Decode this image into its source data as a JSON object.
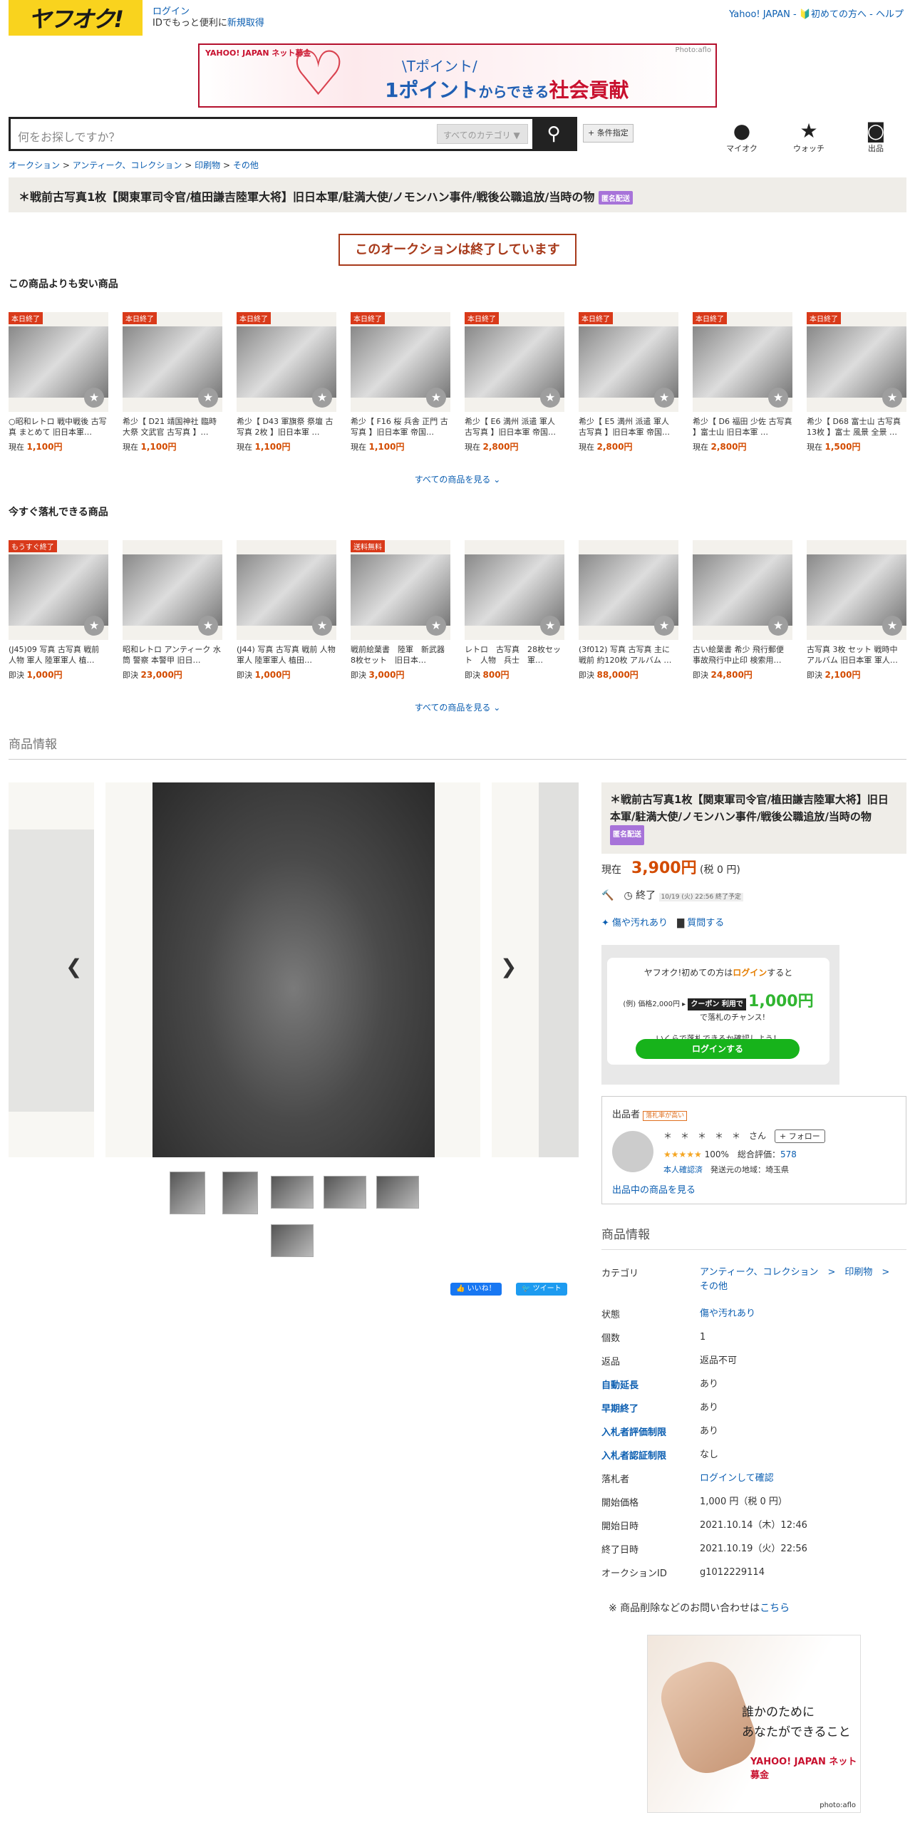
{
  "header": {
    "logo": "ヤフオク!",
    "login": "ログイン",
    "login_sub": "IDでもっと便利に",
    "signup": "新規取得",
    "links": "Yahoo! JAPAN - 🔰初めての方へ - ヘルプ"
  },
  "banner": {
    "brand": "YAHOO! JAPAN ネット募金",
    "line1": "\\Tポイント/",
    "line2a": "1ポイント",
    "line2b": "からできる",
    "line2c": "社会貢献",
    "credit": "Photo:aflo"
  },
  "search": {
    "placeholder": "何をお探しですか？",
    "category": "すべてのカテゴリ",
    "condition": "+ 条件指定"
  },
  "icons": [
    {
      "label": "マイオク",
      "icon": "person-icon"
    },
    {
      "label": "ウォッチ",
      "icon": "star-icon"
    },
    {
      "label": "出品",
      "icon": "camera-icon"
    }
  ],
  "breadcrumb": [
    "オークション",
    "アンティーク、コレクション",
    "印刷物",
    "その他"
  ],
  "title": "＊戦前古写真1枚【関東軍司令官/植田謙吉陸軍大将】旧日本軍/駐満大使/ノモンハン事件/戦後公職追放/当時の物",
  "anon_badge": "匿名配送",
  "ended": "このオークションは終了しています",
  "cheaper": {
    "heading": "この商品よりも安い商品",
    "more": "すべての商品を見る ⌄",
    "items": [
      {
        "tag": "本日終了",
        "name": "○昭和レトロ 戦中戦後 古写真 まとめて 旧日本軍…",
        "kind": "現在",
        "price": "1,100円"
      },
      {
        "tag": "本日終了",
        "name": "希少【 D21 靖国神社 臨時大祭 文武官 古写真 】…",
        "kind": "現在",
        "price": "1,100円"
      },
      {
        "tag": "本日終了",
        "name": "希少【 D43 軍旗祭 祭壇 古写真 2枚 】旧日本軍 …",
        "kind": "現在",
        "price": "1,100円"
      },
      {
        "tag": "本日終了",
        "name": "希少【 F16 桜 兵舎 正門 古写真 】旧日本軍 帝国…",
        "kind": "現在",
        "price": "1,100円"
      },
      {
        "tag": "本日終了",
        "name": "希少【 E6 満州 派遣 軍人 古写真 】旧日本軍 帝国…",
        "kind": "現在",
        "price": "2,800円"
      },
      {
        "tag": "本日終了",
        "name": "希少【 E5 満州 派遣 軍人 古写真 】旧日本軍 帝国…",
        "kind": "現在",
        "price": "2,800円"
      },
      {
        "tag": "本日終了",
        "name": "希少【 D6 福田 少佐 古写真 】富士山 旧日本軍 …",
        "kind": "現在",
        "price": "2,800円"
      },
      {
        "tag": "本日終了",
        "name": "希少【 D68 富士山 古写真 13枚 】富士 風景 全景 …",
        "kind": "現在",
        "price": "1,500円"
      }
    ]
  },
  "buynow": {
    "heading": "今すぐ落札できる商品",
    "more": "すべての商品を見る ⌄",
    "items": [
      {
        "tag": "もうすぐ終了",
        "name": "(J45)09 写真 古写真 戦前 人物 軍人 陸軍軍人 植…",
        "kind": "即決",
        "price": "1,000円"
      },
      {
        "tag": "",
        "name": "昭和レトロ アンティーク 水筒 警察 本警甲 旧日…",
        "kind": "即決",
        "price": "23,000円"
      },
      {
        "tag": "",
        "name": "(J44) 写真 古写真 戦前 人物 軍人 陸軍軍人 植田…",
        "kind": "即決",
        "price": "1,000円"
      },
      {
        "tag": "送料無料",
        "name": "戦前絵葉書　陸軍　新武器　8枚セット　旧日本…",
        "kind": "即決",
        "price": "3,000円"
      },
      {
        "tag": "",
        "name": "レトロ　古写真　28枚セット　人物　兵士　軍…",
        "kind": "即決",
        "price": "800円"
      },
      {
        "tag": "",
        "name": "(3f012) 写真 古写真 主に 戦前 約120枚 アルバム …",
        "kind": "即決",
        "price": "88,000円"
      },
      {
        "tag": "",
        "name": "古い絵葉書 希少 飛行郵便 事故飛行中止印 検索用…",
        "kind": "即決",
        "price": "24,800円"
      },
      {
        "tag": "",
        "name": "古写真 3枚 セット 戦時中 アルバム 旧日本軍 軍人…",
        "kind": "即決",
        "price": "2,100円"
      }
    ]
  },
  "info_heading": "商品情報",
  "detail": {
    "price_label": "現在",
    "price": "3,900円",
    "tax": "(税 0 円)",
    "end_label": "終了",
    "end_date": "10/19 (火) 22:56 終了予定",
    "condition": "傷や汚れあり",
    "question": "質問する"
  },
  "promo": {
    "line1a": "ヤフオク!初めての方は",
    "line1b": "ログイン",
    "line1c": "すると",
    "example": "(例) 価格2,000円",
    "coupon": "クーポン 利用で",
    "amount": "1,000円",
    "chance": "で落札のチャンス!",
    "check": "いくらで落札できるか確認しよう！",
    "button": "ログインする"
  },
  "seller": {
    "label": "出品者",
    "badge": "落札率が高い",
    "name": "＊　＊　＊　＊　＊　さん",
    "follow": "+ フォロー",
    "rate": "100%",
    "total_label": "総合評価：",
    "total": "578",
    "verified": "本人確認済",
    "ship_from": "発送元の地域：埼玉県",
    "link": "出品中の商品を見る"
  },
  "social": {
    "like": "👍 いいね！",
    "tweet": "🐦 ツイート"
  },
  "specs_heading": "商品情報",
  "specs": [
    {
      "k": "カテゴリ",
      "v": "アンティーク、コレクション　>　印刷物　>　その他",
      "kb": false,
      "vl": true
    },
    {
      "k": "状態",
      "v": "傷や汚れあり",
      "kb": false,
      "vl": true
    },
    {
      "k": "個数",
      "v": "1",
      "kb": false,
      "vl": false
    },
    {
      "k": "返品",
      "v": "返品不可",
      "kb": false,
      "vl": false
    },
    {
      "k": "自動延長",
      "v": "あり",
      "kb": true,
      "vl": false
    },
    {
      "k": "早期終了",
      "v": "あり",
      "kb": true,
      "vl": false
    },
    {
      "k": "入札者評価制限",
      "v": "あり",
      "kb": true,
      "vl": false
    },
    {
      "k": "入札者認証制限",
      "v": "なし",
      "kb": true,
      "vl": false
    },
    {
      "k": "落札者",
      "v": "ログインして確認",
      "kb": false,
      "vl": true
    },
    {
      "k": "開始価格",
      "v": "1,000 円（税 0 円）",
      "kb": false,
      "vl": false
    },
    {
      "k": "開始日時",
      "v": "2021.10.14（木）12:46",
      "kb": false,
      "vl": false
    },
    {
      "k": "終了日時",
      "v": "2021.10.19（火）22:56",
      "kb": false,
      "vl": false
    },
    {
      "k": "オークションID",
      "v": "g1012229114",
      "kb": false,
      "vl": false
    }
  ],
  "report": {
    "text": "※ 商品削除などのお問い合わせは",
    "link": "こちら"
  },
  "ad": {
    "line1": "誰かのために",
    "line2": "あなたができること",
    "brand": "YAHOO! JAPAN ネット募金",
    "credit": "photo:aflo"
  }
}
